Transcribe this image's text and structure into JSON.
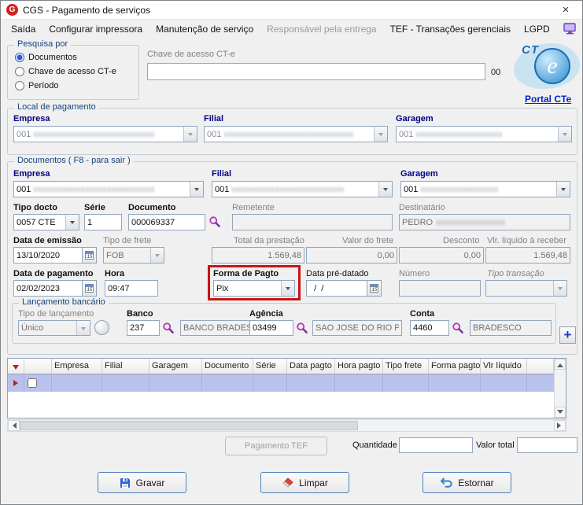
{
  "window": {
    "logo": "G",
    "title": "CGS - Pagamento de serviços",
    "close": "×"
  },
  "menu": {
    "items": [
      {
        "label": "Saída"
      },
      {
        "label": "Configurar impressora"
      },
      {
        "label": "Manutenção de serviço"
      },
      {
        "label": "Responsável pela entrega"
      },
      {
        "label": "TEF - Transações gerenciais"
      },
      {
        "label": "LGPD"
      }
    ]
  },
  "pesquisa": {
    "title": "Pesquisa por",
    "options": [
      "Documentos",
      "Chave de acesso CT-e",
      "Período"
    ]
  },
  "chave": {
    "label": "Chave de acesso CT-e",
    "value": "",
    "counter": "00"
  },
  "logo": {
    "ct": "CT",
    "e": "e",
    "portal": "Portal CTe"
  },
  "local": {
    "title": "Local de pagamento",
    "empresa": {
      "label": "Empresa",
      "code": "001",
      "masked": "xxxxxxxxxxxxxxxxxxxxxxxxxxxx"
    },
    "filial": {
      "label": "Filial",
      "code": "001",
      "masked": "xxxxxxxxxxxxxxxxxxxxxxxxxxxxxx"
    },
    "garagem": {
      "label": "Garagem",
      "code": "001",
      "masked": "xxxxxxxxxxxxxxxxxxxx"
    }
  },
  "docs": {
    "title": "Documentos ( F8 - para sair )",
    "empresa": {
      "label": "Empresa",
      "code": "001",
      "masked": "xxxxxxxxxxxxxxxxxxxxxxxxxxxx"
    },
    "filial": {
      "label": "Filial",
      "code": "001",
      "masked": "xxxxxxxxxxxxxxxxxxxxxxxxxx"
    },
    "garagem": {
      "label": "Garagem",
      "code": "001",
      "masked": "xxxxxxxxxxxxxxxxxx"
    },
    "tipo_docto": {
      "label": "Tipo docto",
      "value": "0057 CTE"
    },
    "serie": {
      "label": "Série",
      "value": "1"
    },
    "documento": {
      "label": "Documento",
      "value": "000069337"
    },
    "remetente": {
      "label": "Remetente",
      "value": ""
    },
    "destinatario": {
      "label": "Destinatário",
      "value": "PEDRO",
      "masked": "xxxxxxxxxxxxxxxx"
    },
    "data_emissao": {
      "label": "Data de emissão",
      "value": "13/10/2020"
    },
    "tipo_frete": {
      "label": "Tipo de frete",
      "value": "FOB"
    },
    "total_prestacao": {
      "label": "Total da prestação",
      "value": "1.569,48"
    },
    "valor_frete": {
      "label": "Valor do frete",
      "value": "0,00"
    },
    "desconto": {
      "label": "Desconto",
      "value": "0,00"
    },
    "vlr_liquido": {
      "label": "Vlr. líquido à receber",
      "value": "1.569,48"
    },
    "data_pagamento": {
      "label": "Data de pagamento",
      "value": "02/02/2023"
    },
    "hora": {
      "label": "Hora",
      "value": "09:47"
    },
    "forma_pagto": {
      "label": "Forma de Pagto",
      "value": "Pix"
    },
    "data_pre_datado": {
      "label": "Data pré-datado",
      "value": "  /  /"
    },
    "numero": {
      "label": "Número",
      "value": ""
    },
    "tipo_transacao": {
      "label": "Tipo transação",
      "value": ""
    }
  },
  "banco_grp": {
    "title": "Lançamento bancário",
    "tipo_lancamento": {
      "label": "Tipo de lançamento",
      "value": "Único"
    },
    "banco": {
      "label": "Banco",
      "code": "237",
      "name": "BANCO BRADESCO"
    },
    "agencia": {
      "label": "Agência",
      "code": "03499",
      "name": "SAO JOSE DO RIO P"
    },
    "conta": {
      "label": "Conta",
      "code": "4460",
      "name": "BRADESCO"
    }
  },
  "grid": {
    "columns": [
      "Empresa",
      "Filial",
      "Garagem",
      "Documento",
      "Série",
      "Data pagto",
      "Hora pagto",
      "Tipo frete",
      "Forma pagto",
      "Vlr líquido"
    ]
  },
  "footer": {
    "tef": "Pagamento TEF",
    "quantidade": {
      "label": "Quantidade",
      "value": ""
    },
    "valor_total": {
      "label": "Valor total",
      "value": ""
    }
  },
  "actions": {
    "gravar": "Gravar",
    "limpar": "Limpar",
    "estornar": "Estornar"
  },
  "colors": {
    "accent": "#000080",
    "highlight": "#c81414",
    "link": "#0024ce",
    "selection": "#b9c2ec",
    "logo_red": "#d62020"
  }
}
